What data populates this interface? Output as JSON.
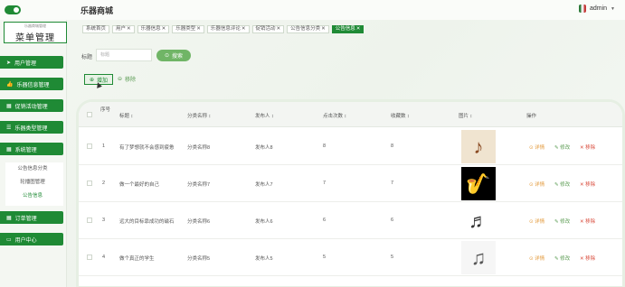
{
  "header": {
    "title": "乐器商城",
    "user": "admin"
  },
  "sidebar": {
    "logo_small": "乐器商城管理",
    "logo_main": "菜单管理",
    "items": [
      {
        "label": "用户管理"
      },
      {
        "label": "乐器信息管理"
      },
      {
        "label": "促销活动管理"
      },
      {
        "label": "乐器类型管理"
      },
      {
        "label": "系统管理"
      },
      {
        "label": "订单管理"
      },
      {
        "label": "用户中心"
      }
    ],
    "subitems": [
      "公告信息分类",
      "轮播图管理",
      "公告信息"
    ]
  },
  "tabs": [
    {
      "label": "系统首页",
      "active": false,
      "closable": false
    },
    {
      "label": "用户",
      "active": false,
      "closable": true
    },
    {
      "label": "乐器信息",
      "active": false,
      "closable": true
    },
    {
      "label": "乐器类型",
      "active": false,
      "closable": true
    },
    {
      "label": "乐器信息评论",
      "active": false,
      "closable": true
    },
    {
      "label": "促销活动",
      "active": false,
      "closable": true
    },
    {
      "label": "公告信息分类",
      "active": false,
      "closable": true
    },
    {
      "label": "公告信息",
      "active": true,
      "closable": true
    }
  ],
  "search": {
    "label": "标题",
    "placeholder": "标题",
    "button": "搜索"
  },
  "toolbar": {
    "add": "增加",
    "remove": "移除"
  },
  "table": {
    "headers": [
      "序号",
      "标题 ↕",
      "分类名称 ↕",
      "发布人 ↕",
      "点击次数 ↕",
      "收藏数 ↕",
      "图片 ↕",
      "操作"
    ],
    "rows": [
      {
        "no": "1",
        "title": "有了梦想就不会感到疲惫",
        "category": "分类名称8",
        "publisher": "发布人8",
        "clicks": "8",
        "favorites": "8",
        "image": "pipa-icon"
      },
      {
        "no": "2",
        "title": "做一个最好的自己",
        "category": "分类名称7",
        "publisher": "发布人7",
        "clicks": "7",
        "favorites": "7",
        "image": "saxophone-icon"
      },
      {
        "no": "3",
        "title": "远大的目标靠成功的磁石",
        "category": "分类名称6",
        "publisher": "发布人6",
        "clicks": "6",
        "favorites": "6",
        "image": "clarinet-icon"
      },
      {
        "no": "4",
        "title": "做个真正的学生",
        "category": "分类名称5",
        "publisher": "发布人5",
        "clicks": "5",
        "favorites": "5",
        "image": "instruments-icon"
      }
    ],
    "actions": {
      "detail": "详情",
      "edit": "修改",
      "remove": "移除"
    }
  },
  "colors": {
    "primary": "#1f8a35",
    "detail": "#e39a3c",
    "remove": "#d94a3a"
  }
}
